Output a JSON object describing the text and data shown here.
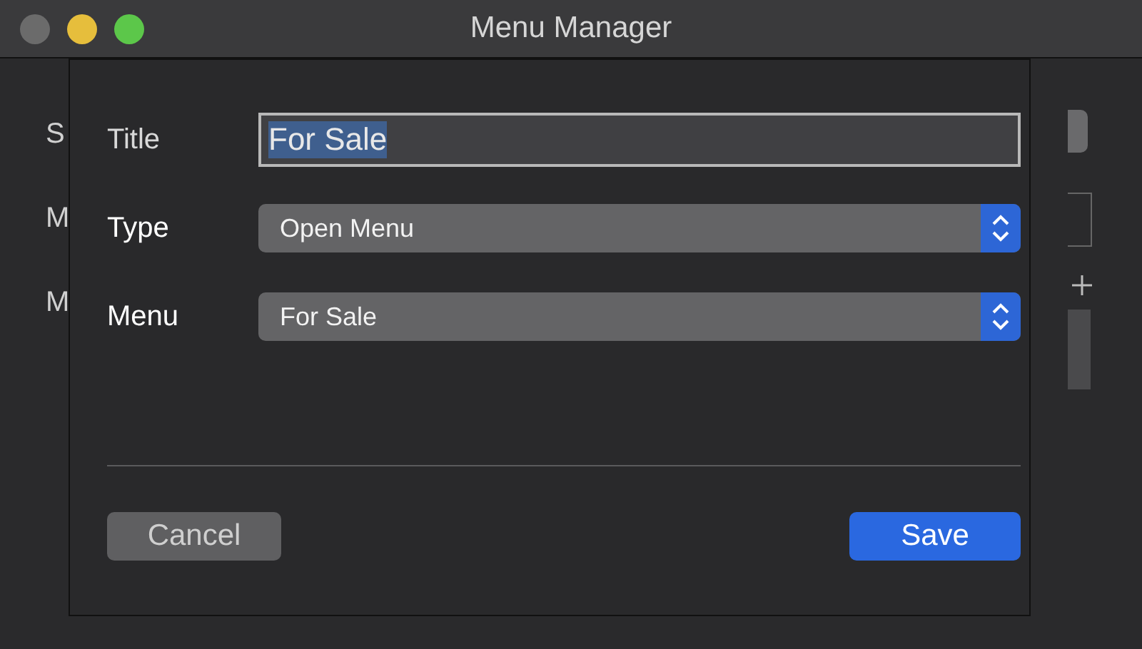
{
  "window": {
    "title": "Menu Manager"
  },
  "background_labels": [
    "S",
    "M",
    "M"
  ],
  "sheet": {
    "fields": [
      {
        "kind": "text",
        "label": "Title",
        "value": "For Sale",
        "text_selected": true
      },
      {
        "kind": "popup",
        "label": "Type",
        "value": "Open Menu"
      },
      {
        "kind": "popup",
        "label": "Menu",
        "value": "For Sale"
      }
    ],
    "buttons": [
      {
        "label": "Cancel",
        "default": false
      },
      {
        "label": "Save",
        "default": true
      }
    ]
  }
}
